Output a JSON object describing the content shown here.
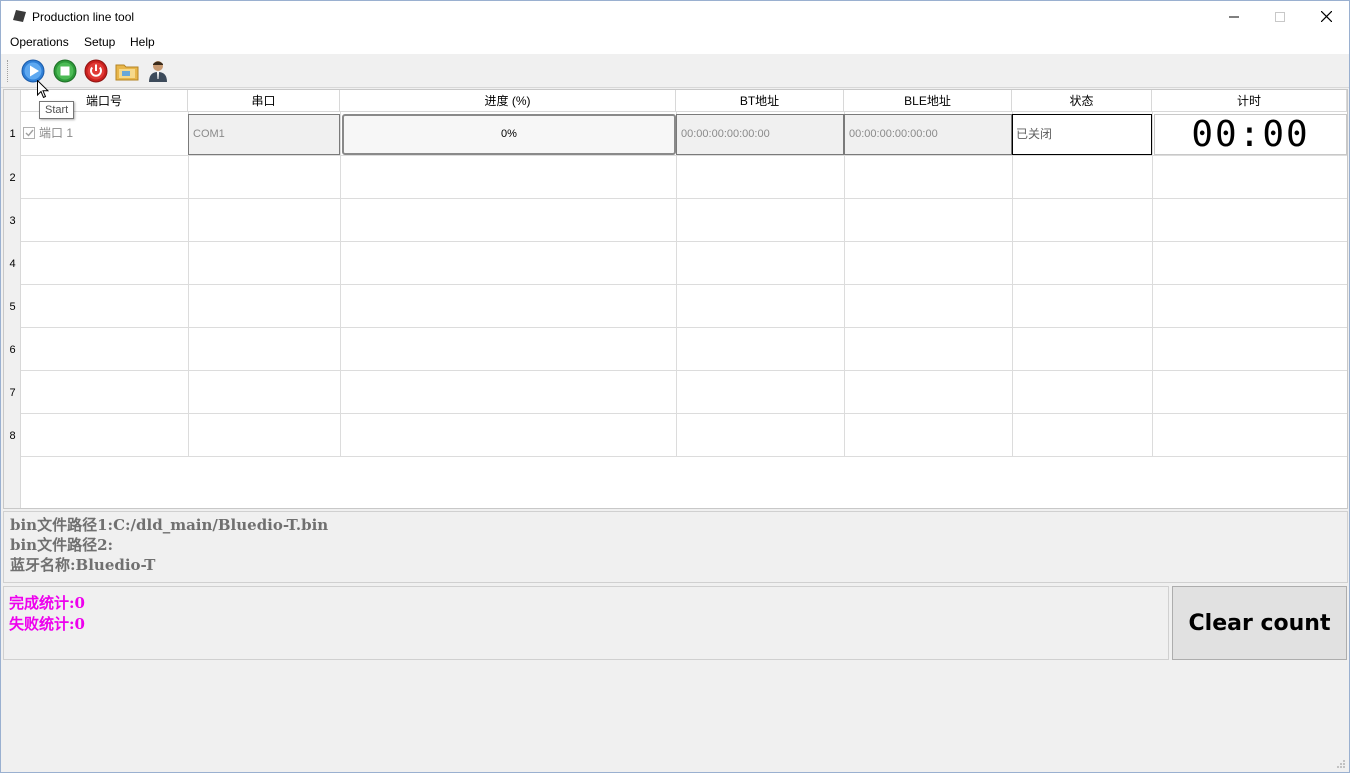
{
  "window": {
    "title": "Production line tool"
  },
  "menu": {
    "items": [
      "Operations",
      "Setup",
      "Help"
    ]
  },
  "toolbar": {
    "buttons": [
      {
        "icon": "play-icon",
        "tooltip": "Start"
      },
      {
        "icon": "stop-icon"
      },
      {
        "icon": "power-icon"
      },
      {
        "icon": "folder-icon"
      },
      {
        "icon": "user-icon"
      }
    ],
    "tooltip": "Start"
  },
  "table": {
    "headers": [
      "端口号",
      "串口",
      "进度 (%)",
      "BT地址",
      "BLE地址",
      "状态",
      "计时"
    ],
    "row_numbers": [
      "1",
      "2",
      "3",
      "4",
      "5",
      "6",
      "7",
      "8"
    ],
    "rows": [
      {
        "port": "端口 1",
        "port_checked": true,
        "serial": "COM1",
        "progress_text": "0%",
        "progress": 0,
        "bt_address": "00:00:00:00:00:00",
        "ble_address": "00:00:00:00:00:00",
        "status": "已关闭",
        "timer": "00:00"
      }
    ]
  },
  "info": {
    "bin_path_1": "bin文件路径1:C:/dld_main/Bluedio-T.bin",
    "bin_path_2": "bin文件路径2:",
    "bt_name": "蓝牙名称:Bluedio-T"
  },
  "stats": {
    "completed": "完成统计:0",
    "failed": "失败统计:0",
    "color": "#ee00ee"
  },
  "clear_button": {
    "label": "Clear count"
  }
}
